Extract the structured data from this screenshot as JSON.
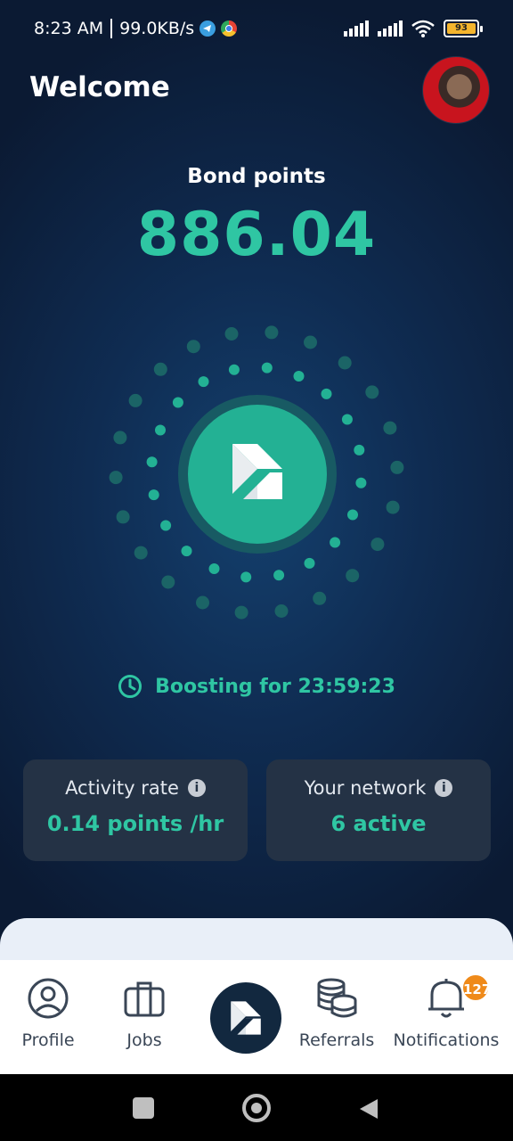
{
  "status_bar": {
    "time": "8:23 AM",
    "speed": "99.0KB/s",
    "battery": "93"
  },
  "header": {
    "welcome": "Welcome"
  },
  "points": {
    "label": "Bond points",
    "value": "886.04"
  },
  "boost": {
    "text": "Boosting for 23:59:23"
  },
  "cards": {
    "activity": {
      "title": "Activity rate",
      "value": "0.14 points /hr"
    },
    "network": {
      "title": "Your network",
      "value": "6 active"
    }
  },
  "nav": {
    "items": [
      {
        "label": "Profile",
        "icon": "user-circle-icon"
      },
      {
        "label": "Jobs",
        "icon": "briefcase-icon"
      },
      {
        "label": "Referrals",
        "icon": "coins-stack-icon"
      },
      {
        "label": "Notifications",
        "icon": "bell-icon"
      }
    ],
    "notification_badge": "127"
  },
  "colors": {
    "accent": "#2fc6a3",
    "background": "#0b1a33",
    "card": "#243245",
    "badge": "#ef8a1a"
  }
}
